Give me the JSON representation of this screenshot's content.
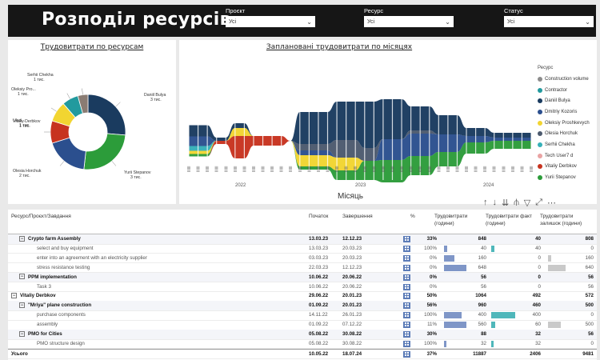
{
  "header": {
    "title": "Розподіл ресурсів",
    "filters": [
      {
        "label": "Проєкт",
        "value": "Усі"
      },
      {
        "label": "Ресурс",
        "value": "Усі"
      },
      {
        "label": "Статус",
        "value": "Усі"
      }
    ]
  },
  "donut": {
    "title": "Трудовитрати по ресурсам",
    "chart_data": {
      "type": "pie",
      "slices": [
        {
          "label": "Daniil Bulya",
          "sub": "3 тис.",
          "value": 3000,
          "color": "#1a3b5f"
        },
        {
          "label": "Yurii Stepanov",
          "sub": "3 тис.",
          "value": 2900,
          "color": "#2c9c3a"
        },
        {
          "label": "Olesia Horchuk",
          "sub": "2 тис.",
          "value": 2100,
          "color": "#2b4f8e"
        },
        {
          "label": "Vitaliy Derbkov",
          "sub": "1 тис.",
          "value": 1100,
          "color": "#c7331f"
        },
        {
          "label": "Oleksiy Pro...",
          "sub": "1 тис.",
          "value": 1000,
          "color": "#f2d531"
        },
        {
          "label": "Ulad...",
          "sub": "1 тис.",
          "value": 800,
          "color": "#229a9e"
        },
        {
          "label": "Serhii Chekha",
          "sub": "1 тис.",
          "value": 500,
          "color": "#8a7c73"
        }
      ]
    }
  },
  "monthly": {
    "title": "Заплановані трудовитрати по місяцях",
    "xlabel": "Місяць",
    "years": [
      "2022",
      "2023",
      "2024"
    ],
    "legend_title": "Ресурс",
    "legend": [
      {
        "name": "Construction volume",
        "color": "#8c8c8c"
      },
      {
        "name": "Contractor",
        "color": "#229a9e"
      },
      {
        "name": "Daniil Bulya",
        "color": "#1a3b5f"
      },
      {
        "name": "Dmitriy Kozoris",
        "color": "#2b4f8e"
      },
      {
        "name": "Oleksiy Proshkevych",
        "color": "#f2d531"
      },
      {
        "name": "Olesia Horchuk",
        "color": "#4c5a6e"
      },
      {
        "name": "Serhii Chekha",
        "color": "#36b0b8"
      },
      {
        "name": "Tech User7 d",
        "color": "#e9a3a3"
      },
      {
        "name": "Vitaliy Derbkov",
        "color": "#c7331f"
      },
      {
        "name": "Yurii Stepanov",
        "color": "#2c9c3a"
      }
    ]
  },
  "table": {
    "headers": {
      "name": "Ресурс/Проєкт/Завдання",
      "start": "Початок",
      "end": "Завершення",
      "pct": "%",
      "work": "Трудовитрати (години)",
      "actual": "Трудовитрати факт (години)",
      "remaining": "Трудовитрати залишок (години)"
    },
    "rows": [
      {
        "level": 1,
        "exp": "⊟",
        "name": "Crypto farm Assembly",
        "start": "13.03.23",
        "end": "12.12.23",
        "pct": "33%",
        "work": "848",
        "actual": "40",
        "remaining": "808",
        "wbar": 0,
        "abar": 0,
        "rbar": 0
      },
      {
        "level": 2,
        "exp": "",
        "name": "select and buy equipment",
        "start": "13.03.23",
        "end": "20.03.23",
        "pct": "100%",
        "work": "40",
        "actual": "40",
        "remaining": "0",
        "wbar": 4,
        "abar": 4,
        "rbar": 0
      },
      {
        "level": 2,
        "exp": "",
        "name": "enter into an agreement with an electricity supplier",
        "start": "03.03.23",
        "end": "20.03.23",
        "pct": "0%",
        "work": "160",
        "actual": "0",
        "remaining": "160",
        "wbar": 13,
        "abar": 0,
        "rbar": 4
      },
      {
        "level": 2,
        "exp": "",
        "name": "stress resistance testing",
        "start": "22.03.23",
        "end": "12.12.23",
        "pct": "0%",
        "work": "648",
        "actual": "0",
        "remaining": "640",
        "wbar": 28,
        "abar": 0,
        "rbar": 22
      },
      {
        "level": 1,
        "exp": "⊟",
        "name": "PPM implementation",
        "start": "10.06.22",
        "end": "20.06.22",
        "pct": "0%",
        "work": "56",
        "actual": "0",
        "remaining": "56",
        "wbar": 0,
        "abar": 0,
        "rbar": 0
      },
      {
        "level": 2,
        "exp": "",
        "name": "Task 3",
        "start": "10.06.22",
        "end": "20.06.22",
        "pct": "0%",
        "work": "56",
        "actual": "0",
        "remaining": "56",
        "wbar": 0,
        "abar": 0,
        "rbar": 0
      },
      {
        "level": 0,
        "exp": "⊟",
        "name": "Vitaliy Derbkov",
        "start": "29.06.22",
        "end": "20.01.23",
        "pct": "50%",
        "work": "1064",
        "actual": "492",
        "remaining": "572",
        "wbar": 0,
        "abar": 0,
        "rbar": 0
      },
      {
        "level": 1,
        "exp": "⊟",
        "name": "\"Mriya\" plane construction",
        "start": "01.09.22",
        "end": "20.01.23",
        "pct": "56%",
        "work": "960",
        "actual": "460",
        "remaining": "500",
        "wbar": 0,
        "abar": 0,
        "rbar": 0
      },
      {
        "level": 2,
        "exp": "",
        "name": "purchase components",
        "start": "14.11.22",
        "end": "26.01.23",
        "pct": "100%",
        "work": "400",
        "actual": "400",
        "remaining": "0",
        "wbar": 22,
        "abar": 30,
        "rbar": 0
      },
      {
        "level": 2,
        "exp": "",
        "name": "assembly",
        "start": "01.09.22",
        "end": "07.12.22",
        "pct": "11%",
        "work": "560",
        "actual": "60",
        "remaining": "500",
        "wbar": 28,
        "abar": 5,
        "rbar": 16
      },
      {
        "level": 1,
        "exp": "⊟",
        "name": "PMO for Cities",
        "start": "05.08.22",
        "end": "30.08.22",
        "pct": "30%",
        "work": "88",
        "actual": "32",
        "remaining": "56",
        "wbar": 0,
        "abar": 0,
        "rbar": 0
      },
      {
        "level": 2,
        "exp": "",
        "name": "PMO structure design",
        "start": "05.08.22",
        "end": "30.08.22",
        "pct": "100%",
        "work": "32",
        "actual": "32",
        "remaining": "0",
        "wbar": 3,
        "abar": 3,
        "rbar": 0
      },
      {
        "level": 3,
        "exp": "",
        "name": "Усього",
        "start": "10.05.22",
        "end": "18.07.24",
        "pct": "37%",
        "work": "11887",
        "actual": "2406",
        "remaining": "9481",
        "wbar": 0,
        "abar": 0,
        "rbar": 0
      }
    ]
  },
  "toolbar": [
    "↑",
    "↓",
    "⇊",
    "⫛",
    "▽",
    "⤢",
    "⋯"
  ]
}
